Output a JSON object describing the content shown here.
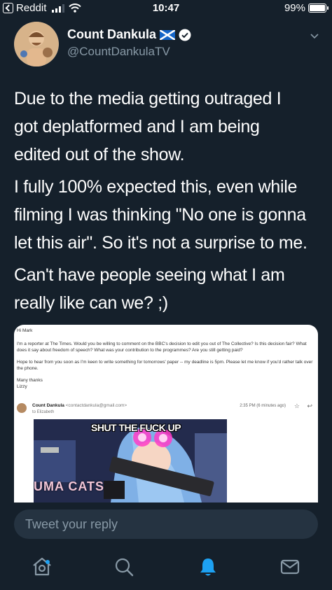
{
  "status_bar": {
    "back_app": "Reddit",
    "time": "10:47",
    "battery": "99%",
    "battery_level": 0.99
  },
  "header": {
    "display_name": "Count Dankula",
    "handle": "@CountDankulaTV"
  },
  "tweet": {
    "paragraphs": [
      [
        "Due to the media getting outraged I",
        "got deplatformed and I am being",
        "edited out of the show."
      ],
      [
        "I fully 100% expected this, even while",
        "filming I was thinking \"No one is gonna",
        "let this air\". So it's not a surprise to me."
      ],
      [
        "Can't have people seeing what I am",
        "really like can we? ;)"
      ]
    ]
  },
  "media": {
    "email": {
      "greeting": "Hi Mark",
      "paragraph1": "I'm a reporter at The Times. Would you be willing to comment on the BBC's decision to edit you out of The Collective? Is this decision fair? What does it say about freedom of speech? What was your contribution to the programmes? Are you still getting paid?",
      "paragraph2": "Hope to hear from you soon as I'm keen to write something for tomorrows' paper -- my deadline is 5pm. Please let me know if you'd rather talk over the phone.",
      "signoff": "Many thanks",
      "signature": "Lizzy"
    },
    "reply": {
      "sender_name": "Count Dankula",
      "sender_email": "<contactdankula@gmail.com>",
      "to": "to Elizabeth",
      "time": "2:35 PM (6 minutes ago)"
    },
    "meme": {
      "caption": "SHUT THE FUCK UP",
      "sign_text": "UMA CATS"
    }
  },
  "reply_bar": {
    "placeholder": "Tweet your reply"
  },
  "icons": {
    "home": "home-icon",
    "search": "search-icon",
    "notifications": "bell-icon",
    "messages": "mail-icon"
  },
  "colors": {
    "background": "#15202b",
    "accent": "#1da1f2",
    "muted": "#8899a6"
  }
}
